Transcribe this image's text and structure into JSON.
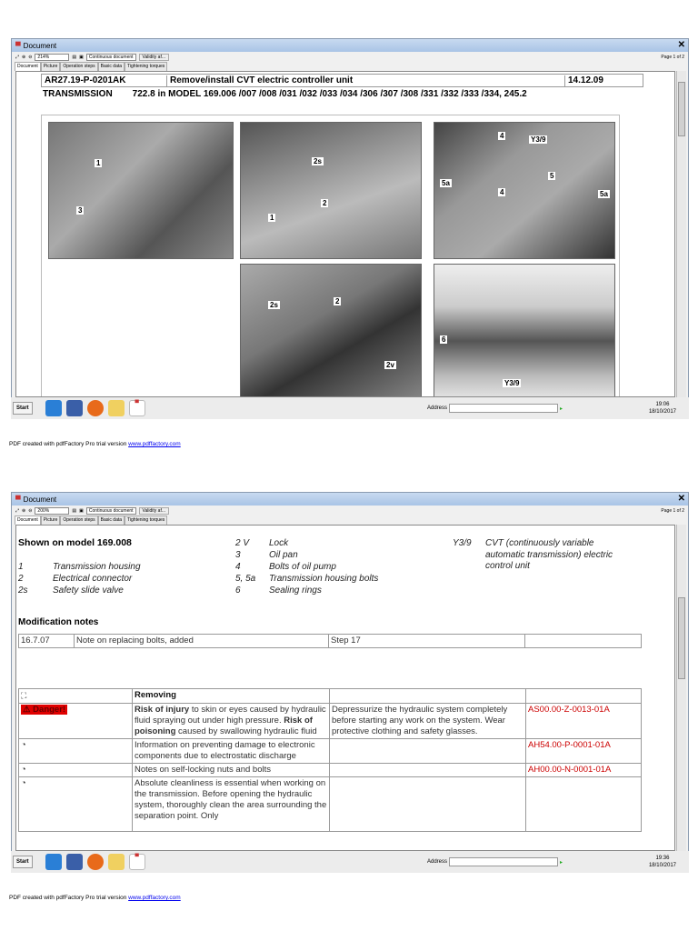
{
  "windows": [
    {
      "title": "Document",
      "zoom": "214%",
      "view_mode": "Continuous document",
      "validity_button": "Validity af...",
      "page_indicator": "Page 1 of 2",
      "tabs": [
        "Document",
        "Picture",
        "Operation steps",
        "Basic data",
        "Tightening torques"
      ],
      "clock": {
        "time": "19:06",
        "date": "18/10/2017"
      }
    },
    {
      "title": "Document",
      "zoom": "200%",
      "view_mode": "Continuous document",
      "validity_button": "Validity af...",
      "page_indicator": "Page 1 of 2",
      "tabs": [
        "Document",
        "Picture",
        "Operation steps",
        "Basic data",
        "Tightening torques"
      ],
      "clock": {
        "time": "19:36",
        "date": "18/10/2017"
      }
    }
  ],
  "page1": {
    "doc_id": "AR27.19-P-0201AK",
    "doc_title": "Remove/install CVT electric controller unit",
    "doc_date": "14.12.09",
    "section": "TRANSMISSION",
    "models": "722.8 in MODEL 169.006 /007 /008 /031 /032 /033 /034 /306 /307 /308 /331 /332 /333 /334, 245.2",
    "labels": {
      "p1a": "1",
      "p1b": "3",
      "p2a": "2s",
      "p2b": "2",
      "p2c": "1",
      "p3a": "4",
      "p3b": "Y3/9",
      "p3c": "5a",
      "p3d": "5",
      "p3e": "4",
      "p3f": "5a",
      "p4a": "2s",
      "p4b": "2",
      "p4c": "2v",
      "p5a": "6",
      "p5b": "Y3/9"
    }
  },
  "page2": {
    "shown_on": "Shown on model 169.008",
    "legend_left": [
      {
        "k": "1",
        "v": "Transmission housing"
      },
      {
        "k": "2",
        "v": "Electrical connector"
      },
      {
        "k": "2s",
        "v": "Safety slide valve"
      }
    ],
    "legend_mid": [
      {
        "k": "2 V",
        "v": "Lock"
      },
      {
        "k": "3",
        "v": "Oil pan"
      },
      {
        "k": "4",
        "v": "Bolts of oil pump"
      },
      {
        "k": "5, 5a",
        "v": "Transmission housing bolts"
      },
      {
        "k": "6",
        "v": "Sealing rings"
      }
    ],
    "legend_right": {
      "k": "Y3/9",
      "v": "CVT (continuously variable automatic transmission) electric control unit"
    },
    "mod_heading": "Modification notes",
    "mod_row": {
      "date": "16.7.07",
      "note": "Note on replacing bolts, added",
      "step": "Step 17"
    },
    "removing": "Removing",
    "danger": "Danger!",
    "rows": [
      {
        "b1": "Risk of injury",
        "t1": " to skin or eyes caused by hydraulic fluid spraying out under high pressure. ",
        "b2": "Risk of poisoning",
        "t2": " caused by swallowing hydraulic fluid",
        "action": "Depressurize the hydraulic system completely before starting any work on the system. Wear protective clothing and safety glasses.",
        "ref": "AS00.00-Z-0013-01A"
      },
      {
        "text": "Information on preventing damage to electronic components due to electrostatic discharge",
        "ref": "AH54.00-P-0001-01A"
      },
      {
        "text": "Notes on self-locking nuts and bolts",
        "ref": "AH00.00-N-0001-01A"
      },
      {
        "text": "Absolute cleanliness is essential when working on the transmission. Before opening the hydraulic system, thoroughly clean the area surrounding the separation point. Only"
      }
    ]
  },
  "taskbar": {
    "start": "Start",
    "address_label": "Address"
  },
  "footer": {
    "text": "PDF created with pdfFactory Pro trial version ",
    "link": "www.pdffactory.com"
  },
  "colors": {
    "danger": "#e00000",
    "ref": "#c00000",
    "titlebar": "#b8d0ec"
  }
}
